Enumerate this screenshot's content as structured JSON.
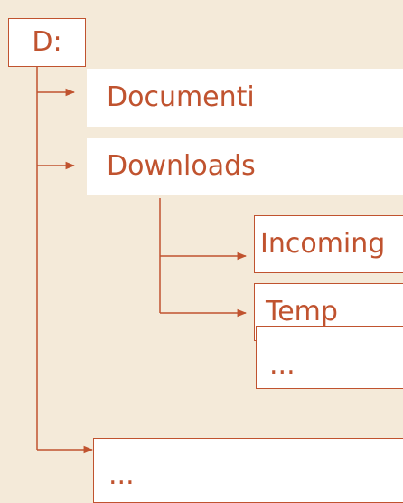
{
  "diagram": {
    "root": {
      "label": "D:"
    },
    "children": [
      {
        "label": "Documenti"
      },
      {
        "label": "Downloads",
        "children": [
          {
            "label": "Incoming"
          },
          {
            "label": "Temp"
          },
          {
            "label": "..."
          }
        ]
      },
      {
        "label": "..."
      }
    ],
    "colors": {
      "background": "#f4ead9",
      "box_fill": "#ffffff",
      "accent": "#c0532f"
    }
  }
}
